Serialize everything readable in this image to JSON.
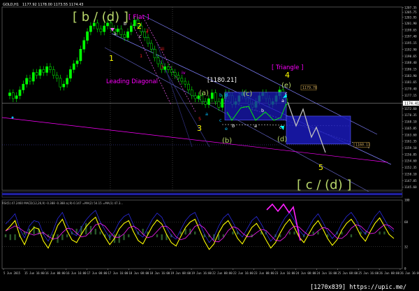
{
  "header": {
    "symbol": "GOLD,H1",
    "ohlc": "1177.92 1178.00 1173.55 1174.43"
  },
  "indicator_header": "RSI(5) 47.2460  MACD(12,26,9) -0.388 -0.388  a(,9)-0.147  =MA(2) 54.15  =MA(1) 47.3...",
  "watermark": "[1270x839] https://upic.me/",
  "colors": {
    "up_candle": "#00ff00",
    "down_candle": "#00ff00",
    "box": "#1010b0",
    "magenta": "#ff00ff",
    "yellow": "#ffff00",
    "wave_green": "#b7d66a",
    "cyan": "#00ffff"
  },
  "chart_data": {
    "type": "candlestick",
    "title": "",
    "xlabel": "",
    "ylabel": "",
    "ylim": [
      1144.5,
      1207.5
    ],
    "y_ticks": [
      1207.35,
      1205.75,
      1203.95,
      1201.9,
      1199.65,
      1197.4,
      1195.15,
      1192.9,
      1190.65,
      1188.4,
      1186.15,
      1183.9,
      1181.65,
      1179.4,
      1177.15,
      1174.41,
      1172.6,
      1170.35,
      1168.1,
      1165.85,
      1163.6,
      1161.35,
      1159.1,
      1156.85,
      1154.6,
      1152.35,
      1150.1,
      1147.85,
      1145.6
    ],
    "x_ticks": [
      "5 Jun 2015",
      "15 Jun 16:00",
      "16 Jun 08:00",
      "16 Jun 16:00",
      "17 Jun 08:00",
      "17 Jun 16:00",
      "18 Jun 08:00",
      "18 Jun 16:00",
      "19 Jun 08:00",
      "19 Jun 16:00",
      "22 Jun 08:00",
      "22 Jun 16:00",
      "23 Jun 08:00",
      "23 Jun 16:00",
      "24 Jun 08:00",
      "24 Jun 16:00",
      "25 Jun 08:00",
      "25 Jun 16:00",
      "26 Jun 08:00",
      "26 Jun 16:00"
    ],
    "price_line": 1174.41,
    "price_labels": [
      {
        "text": "1179.78",
        "value": 1179.78
      },
      {
        "text": "1160.13",
        "value": 1160.13
      }
    ],
    "series": [
      {
        "values": [
          1178,
          1176,
          1177,
          1179,
          1181,
          1183,
          1182,
          1185,
          1184,
          1186,
          1185,
          1187,
          1186,
          1184,
          1183,
          1180,
          1181,
          1183,
          1186,
          1188,
          1189,
          1193,
          1196,
          1199,
          1201,
          1202,
          1200,
          1199,
          1201,
          1202,
          1200,
          1199,
          1200,
          1198,
          1197,
          1199,
          1201,
          1203,
          1201,
          1199,
          1197,
          1195,
          1193,
          1190,
          1188,
          1186,
          1187,
          1186,
          1185,
          1184,
          1183,
          1182,
          1181,
          1179,
          1177,
          1176,
          1177,
          1175,
          1174,
          1176,
          1178,
          1175,
          1173,
          1176,
          1178,
          1177,
          1174,
          1175,
          1177,
          1178,
          1176,
          1174,
          1173,
          1175,
          1177,
          1178,
          1176,
          1174,
          1175,
          1177,
          1179,
          1176,
          1174
        ]
      }
    ],
    "indicator": {
      "name": "RSI(5) / MACD",
      "ylim": [
        0,
        100
      ],
      "y_ticks": [
        100,
        68,
        32,
        0
      ],
      "rsi": [
        55,
        62,
        70,
        48,
        35,
        52,
        60,
        58,
        40,
        30,
        45,
        63,
        72,
        55,
        42,
        38,
        50,
        61,
        69,
        75,
        58,
        46,
        35,
        44,
        58,
        66,
        70,
        54,
        41,
        36,
        49,
        62,
        71,
        65,
        50,
        38,
        33,
        47,
        60,
        68,
        72,
        56,
        40,
        28,
        36,
        52,
        64,
        70,
        58,
        44,
        36,
        48,
        60,
        66,
        55,
        42,
        30,
        38,
        52,
        64,
        72,
        60,
        46,
        38,
        50,
        62,
        70,
        58,
        44,
        34,
        42,
        56,
        66,
        72,
        62,
        48,
        40,
        54,
        66,
        74,
        62,
        50,
        44
      ],
      "macd": [
        -1,
        -2,
        -2,
        -1,
        1,
        2,
        3,
        2,
        1,
        -1,
        -2,
        -3,
        -2,
        -1,
        1,
        2,
        3,
        4,
        3,
        2,
        1,
        -1,
        -2,
        -3,
        -3,
        -2,
        -1,
        0,
        1,
        2,
        1,
        0,
        -1,
        -2,
        -2,
        -1,
        0,
        1,
        2,
        2,
        1,
        0,
        -1,
        -1,
        -2,
        -2,
        -1,
        0,
        1,
        1,
        0,
        -1,
        -1,
        0,
        1,
        1,
        0,
        -1,
        -1,
        0,
        1,
        1,
        0,
        -1,
        0,
        1,
        1,
        0,
        -1,
        0,
        1,
        1,
        0,
        -1,
        0,
        1,
        1,
        0,
        0,
        1,
        1,
        0,
        0
      ]
    },
    "annotations": [
      {
        "text": "[ b / (d) ]",
        "color": "#b7d66a"
      },
      {
        "text": "[ Flat ]",
        "color": "#ff00ff"
      },
      {
        "text": "2",
        "color": "#ffff00"
      },
      {
        "text": "1",
        "color": "#ffff00"
      },
      {
        "text": "3",
        "color": "#ffff00"
      },
      {
        "text": "4",
        "color": "#ffff00"
      },
      {
        "text": "5",
        "color": "#ffff00"
      },
      {
        "text": "Leading Diagonal",
        "color": "#ff00ff"
      },
      {
        "text": "[1180.21]",
        "color": "#ffffff"
      },
      {
        "text": "(a)",
        "color": "#b7d66a"
      },
      {
        "text": "(b)",
        "color": "#b7d66a"
      },
      {
        "text": "(c)",
        "color": "#b7d66a"
      },
      {
        "text": "(d)",
        "color": "#b7d66a"
      },
      {
        "text": "(e)",
        "color": "#b7d66a"
      },
      {
        "text": "[ Triangle ]",
        "color": "#ff00ff"
      },
      {
        "text": "[ c / (d) ]",
        "color": "#b7d66a"
      }
    ]
  }
}
